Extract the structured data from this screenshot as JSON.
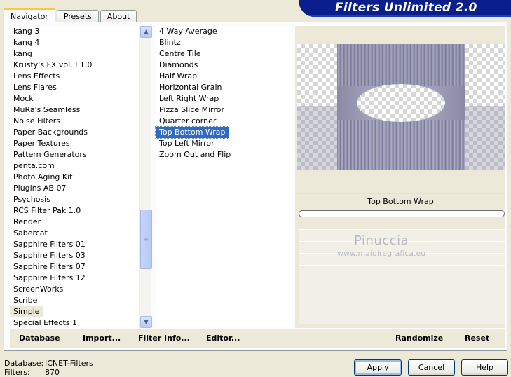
{
  "banner": {
    "title": "Filters Unlimited 2.0"
  },
  "tabs": [
    {
      "label": "Navigator",
      "active": true
    },
    {
      "label": "Presets",
      "active": false
    },
    {
      "label": "About",
      "active": false
    }
  ],
  "categories": [
    "kang 3",
    "kang 4",
    "kang",
    "Krusty's FX vol. I 1.0",
    "Lens Effects",
    "Lens Flares",
    "Mock",
    "MuRa's Seamless",
    "Noise Filters",
    "Paper Backgrounds",
    "Paper Textures",
    "Pattern Generators",
    "penta.com",
    "Photo Aging Kit",
    "Plugins AB 07",
    "Psychosis",
    "RCS Filter Pak 1.0",
    "Render",
    "Sabercat",
    "Sapphire Filters 01",
    "Sapphire Filters 03",
    "Sapphire Filters 07",
    "Sapphire Filters 12",
    "ScreenWorks",
    "Scribe",
    "Simple",
    "Special Effects 1"
  ],
  "selected_category": "Simple",
  "filters": [
    "4 Way Average",
    "Blintz",
    "Centre Tile",
    "Diamonds",
    "Half Wrap",
    "Horizontal Grain",
    "Left Right Wrap",
    "Pizza Slice Mirror",
    "Quarter corner",
    "Top Bottom Wrap",
    "Top Left Mirror",
    "Zoom Out and Flip"
  ],
  "selected_filter": "Top Bottom Wrap",
  "preview": {
    "filter_name": "Top Bottom Wrap"
  },
  "watermark": {
    "line1": "Pinuccia",
    "line2": "www.maidiregrafica.eu"
  },
  "toolbar": {
    "database": "Database",
    "import": "Import...",
    "filter_info": "Filter Info...",
    "editor": "Editor...",
    "randomize": "Randomize",
    "reset": "Reset"
  },
  "footer": {
    "database_label": "Database:",
    "database_value": "ICNET-Filters",
    "filters_label": "Filters:",
    "filters_value": "870"
  },
  "buttons": {
    "apply": "Apply",
    "cancel": "Cancel",
    "help": "Help"
  }
}
